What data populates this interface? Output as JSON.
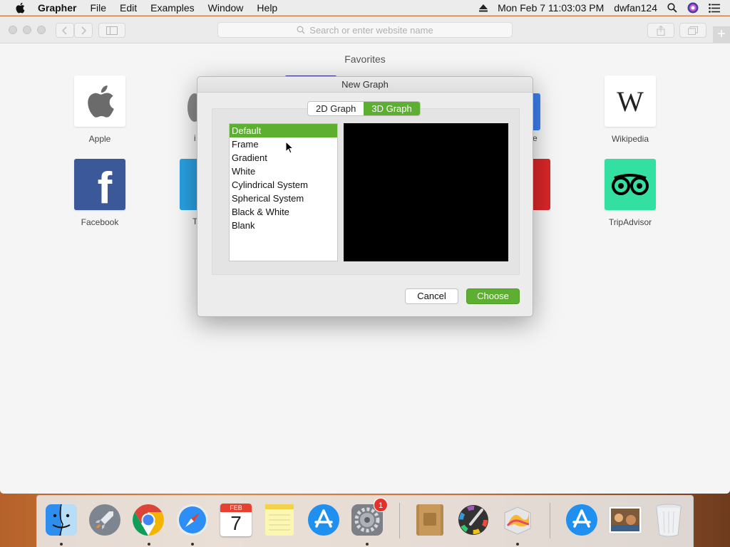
{
  "menubar": {
    "app_name": "Grapher",
    "menus": [
      "File",
      "Edit",
      "Examples",
      "Window",
      "Help"
    ],
    "clock": "Mon Feb 7  11:03:03 PM",
    "user": "dwfan124"
  },
  "browser": {
    "url_placeholder": "Search or enter website name",
    "favorites_title": "Favorites",
    "favorites": [
      {
        "label": "Apple",
        "icon": "apple-logo-icon"
      },
      {
        "label": "Wikipedia",
        "icon": "wikipedia-icon"
      },
      {
        "label": "Facebook",
        "icon": "facebook-icon"
      },
      {
        "label": "TripAdvisor",
        "icon": "tripadvisor-icon"
      }
    ],
    "partial_labels": [
      "i",
      "e",
      "T"
    ]
  },
  "dialog": {
    "title": "New Graph",
    "tabs": [
      "2D Graph",
      "3D Graph"
    ],
    "selected_tab": "3D Graph",
    "templates": [
      "Default",
      "Frame",
      "Gradient",
      "White",
      "Cylindrical System",
      "Spherical System",
      "Black & White",
      "Blank"
    ],
    "selected_template": "Default",
    "cancel_label": "Cancel",
    "choose_label": "Choose"
  },
  "dock": {
    "items": [
      "Finder",
      "Launchpad",
      "Chrome",
      "Safari",
      "Calendar",
      "Notes",
      "App Store",
      "System Preferences",
      "Books",
      "Color Picker",
      "Grapher",
      "App Store Downloads",
      "Photo",
      "Trash"
    ],
    "calendar_month": "FEB",
    "calendar_day": "7",
    "badge_count": "1"
  },
  "colors": {
    "accent_green": "#5daf32",
    "facebook_blue": "#3b5998",
    "tripadvisor_green": "#34e0a1"
  }
}
